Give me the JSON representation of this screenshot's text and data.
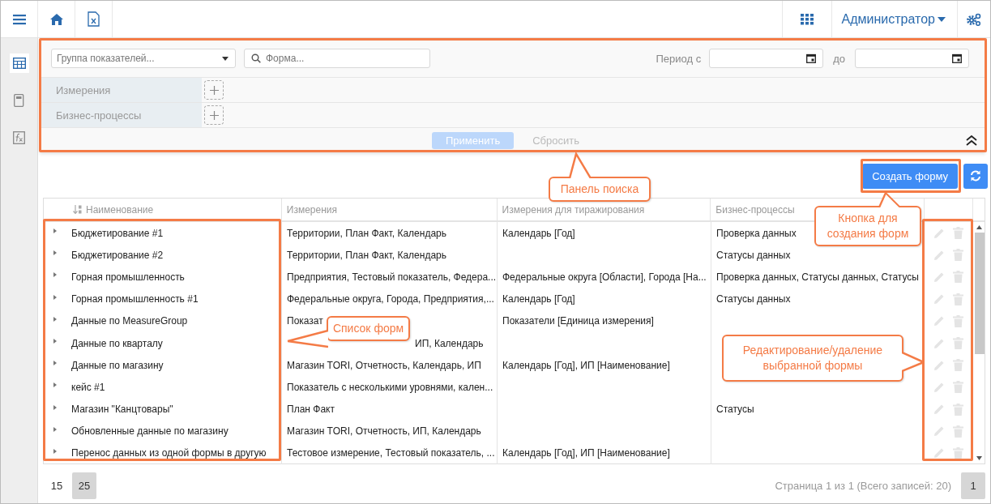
{
  "topbar": {
    "user": "Администратор"
  },
  "filters": {
    "group": {
      "placeholder": "Группа показателей..."
    },
    "search": {
      "placeholder": "Форма..."
    },
    "period_from_label": "Период с",
    "period_to_label": "до",
    "rows": [
      {
        "label": "Измерения"
      },
      {
        "label": "Бизнес-процессы"
      }
    ],
    "apply": {
      "label": "Применить",
      "disabled": true
    },
    "reset": {
      "label": "Сбросить",
      "disabled": true
    }
  },
  "toolbar": {
    "create": "Создать форму"
  },
  "table": {
    "columns": [
      "Наименование",
      "Измерения",
      "Измерения для тиражирования",
      "Бизнес-процессы"
    ],
    "rows": [
      {
        "name": "Бюджетирование #1",
        "measures": "Территории, План Факт, Календарь",
        "replication": "Календарь [Год]",
        "processes": "Проверка данных"
      },
      {
        "name": "Бюджетирование #2",
        "measures": "Территории, План Факт, Календарь",
        "processes": "Статусы данных"
      },
      {
        "name": "Горная промышленность",
        "measures": "Предприятия, Тестовый показатель, Федера...",
        "replication": "Федеральные округа [Области], Города [На...",
        "processes": "Проверка данных, Статусы данных, Статусы"
      },
      {
        "name": "Горная промышленность #1",
        "measures": "Федеральные округа, Города, Предприятия,...",
        "replication": "Календарь [Год]",
        "processes": "Статусы данных"
      },
      {
        "name": "Данные по MeasureGroup",
        "measures": "Показат",
        "replication": "Показатели [Единица измерения]"
      },
      {
        "name": "Данные по кварталу",
        "measures": "ИП, Календарь",
        "measures_covered": true
      },
      {
        "name": "Данные по магазину",
        "measures": "Магазин TORI, Отчетность, Календарь, ИП",
        "replication": "Календарь [Год], ИП [Наименование]"
      },
      {
        "name": "кейс #1",
        "measures": "Показатель с несколькими уровнями, кален..."
      },
      {
        "name": "Магазин \"Канцтовары\"",
        "measures": "План Факт",
        "processes": "Статусы"
      },
      {
        "name": "Обновленные данные по магазину",
        "measures": "Магазин TORI, Отчетность, ИП, Календарь"
      },
      {
        "name": "Перенос данных из одной формы в другую",
        "measures": "Тестовое измерение, Тестовый показатель, ...",
        "replication": "Календарь [Год], ИП [Наименование]"
      }
    ]
  },
  "pager": {
    "sizes": [
      {
        "label": "15",
        "selected": false
      },
      {
        "label": "25",
        "selected": true
      }
    ],
    "summary": "Страница 1 из 1 (Всего записей: 20)",
    "pages": [
      {
        "label": "1",
        "selected": true
      }
    ]
  },
  "callouts": [
    "Панель поиска",
    "Кнопка для создания форм",
    "Список форм",
    "Редактирование/удаление выбранной формы"
  ]
}
